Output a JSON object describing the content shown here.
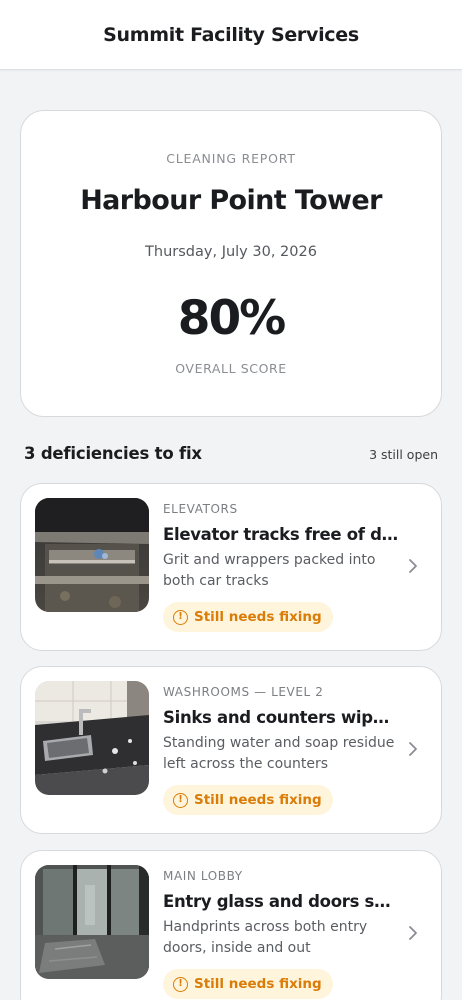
{
  "header": {
    "title": "Summit Facility Services"
  },
  "report": {
    "eyebrow": "CLEANING REPORT",
    "building": "Harbour Point Tower",
    "date": "Thursday, July 30, 2026",
    "score": "80%",
    "score_label": "OVERALL SCORE"
  },
  "deficiencies": {
    "title": "3 deficiencies to fix",
    "open_count": "3 still open",
    "items": [
      {
        "area": "ELEVATORS",
        "title": "Elevator tracks free of debris",
        "description": "Grit and wrappers packed into both car tracks",
        "status": "Still needs fixing",
        "status_icon": "alert-circle-icon",
        "photo": "elevator-track-photo"
      },
      {
        "area": "WASHROOMS — LEVEL 2",
        "title": "Sinks and counters wiped dry",
        "description": "Standing water and soap residue left across the counters",
        "status": "Still needs fixing",
        "status_icon": "alert-circle-icon",
        "photo": "washroom-sink-photo"
      },
      {
        "area": "MAIN LOBBY",
        "title": "Entry glass and doors spotless",
        "description": "Handprints across both entry doors, inside and out",
        "status": "Still needs fixing",
        "status_icon": "alert-circle-icon",
        "photo": "lobby-doors-photo"
      }
    ]
  },
  "colors": {
    "background": "#f2f3f4",
    "card": "#ffffff",
    "text": "#1b1c1f",
    "muted": "#8a8d92",
    "warning": "#d97c08",
    "warning_bg": "#fff5dc"
  }
}
